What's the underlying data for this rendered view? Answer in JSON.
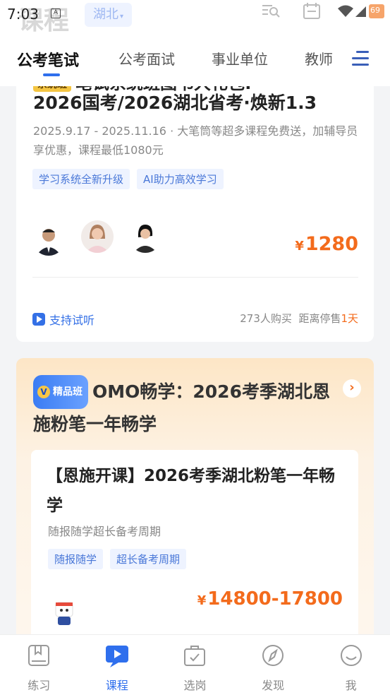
{
  "status": {
    "time": "7:03",
    "a_indicator": "A",
    "battery": "69"
  },
  "header": {
    "ghost_title": "课程",
    "region": "湖北"
  },
  "tabs": [
    {
      "label": "公考笔试",
      "active": true
    },
    {
      "label": "公考面试"
    },
    {
      "label": "事业单位"
    },
    {
      "label": "教师"
    }
  ],
  "card1": {
    "badge": "系统班",
    "title_line1": "笔试系统班图书大礼包:",
    "title_line2": "2026国考/2026湖北省考·焕新1.3",
    "description": "2025.9.17 - 2025.11.16 · 大笔筒等超多课程免费送，加辅导员享优惠，课程最低1080元",
    "tags": [
      "学习系统全新升级",
      "AI助力高效学习"
    ],
    "price_symbol": "¥",
    "price": "1280",
    "trial_label": "支持试听",
    "buyers": "273人购买",
    "stop_prefix": "距离停售",
    "stop_value": "1天"
  },
  "card2": {
    "badge": "精品班",
    "title": "OMO畅学：2026考季湖北恩施粉笔一年畅学",
    "inner_title": "【恩施开课】2026考季湖北粉笔一年畅学",
    "inner_subtitle": "随报随学超长备考周期",
    "tags": [
      "随报随学",
      "超长备考周期"
    ],
    "price_symbol": "¥",
    "price": "14800-17800"
  },
  "bottom_nav": [
    {
      "label": "练习",
      "icon": "book-icon"
    },
    {
      "label": "课程",
      "icon": "video-icon",
      "active": true
    },
    {
      "label": "选岗",
      "icon": "briefcase-icon"
    },
    {
      "label": "发现",
      "icon": "compass-icon"
    },
    {
      "label": "我",
      "icon": "profile-icon"
    }
  ],
  "colors": {
    "accent": "#2f6fed",
    "price": "#f36b1c",
    "tag_bg": "#eef3ff"
  }
}
